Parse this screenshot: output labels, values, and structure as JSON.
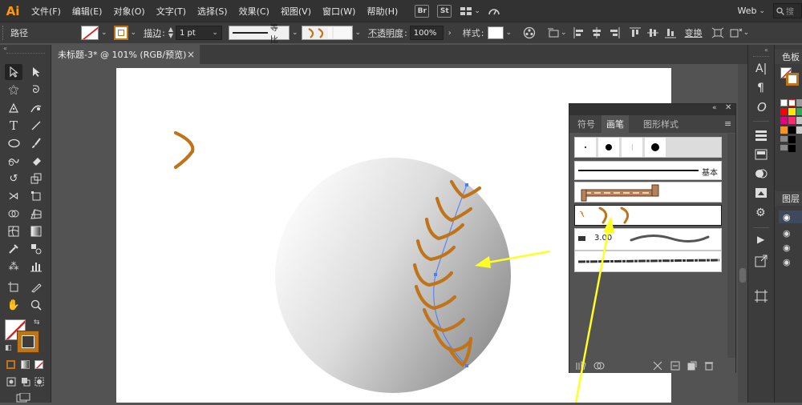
{
  "app": {
    "logo": "Ai"
  },
  "menu": [
    "文件(F)",
    "编辑(E)",
    "对象(O)",
    "文字(T)",
    "选择(S)",
    "效果(C)",
    "视图(V)",
    "窗口(W)",
    "帮助(H)"
  ],
  "menubar_right": {
    "br_label": "Br",
    "st_label": "St",
    "workspace": "Web",
    "search_placeholder": "搜"
  },
  "control_bar": {
    "object_type": "路径",
    "stroke_label": "描边",
    "stroke_weight": "1 pt",
    "profile_label": "等比",
    "opacity_label": "不透明度",
    "opacity_value": "100%",
    "style_label": "样式",
    "transform_label": "变换"
  },
  "document_tab": {
    "title": "未标题-3* @ 101% (RGB/预览)",
    "close": "×"
  },
  "brushes_panel": {
    "tabs": [
      "符号",
      "画笔",
      "图形样式"
    ],
    "active_tab": "画笔",
    "basic_label": "基本",
    "scatter_value": "3.00"
  },
  "far_right_panels": {
    "swatches_label": "色板",
    "layers_label": "图层"
  },
  "colors": {
    "orange_stroke": "#c0741a",
    "accent_blue": "#4a7cff",
    "arrow_yellow": "#ffff22"
  }
}
